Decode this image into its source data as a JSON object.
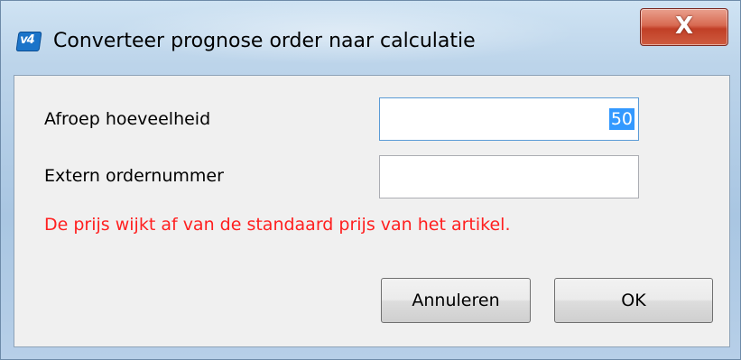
{
  "window": {
    "title": "Converteer prognose order naar calculatie",
    "app_icon_text": "v4",
    "close_glyph": "X"
  },
  "form": {
    "afroep_label": "Afroep hoeveelheid",
    "afroep_value": "50",
    "extern_label": "Extern ordernummer",
    "extern_value": "",
    "warning": "De prijs wijkt af van de standaard prijs van het artikel."
  },
  "buttons": {
    "cancel": "Annuleren",
    "ok": "OK"
  },
  "colors": {
    "warning_text": "#ff2020",
    "selection": "#3399ff",
    "close_button": "#c13f26"
  }
}
